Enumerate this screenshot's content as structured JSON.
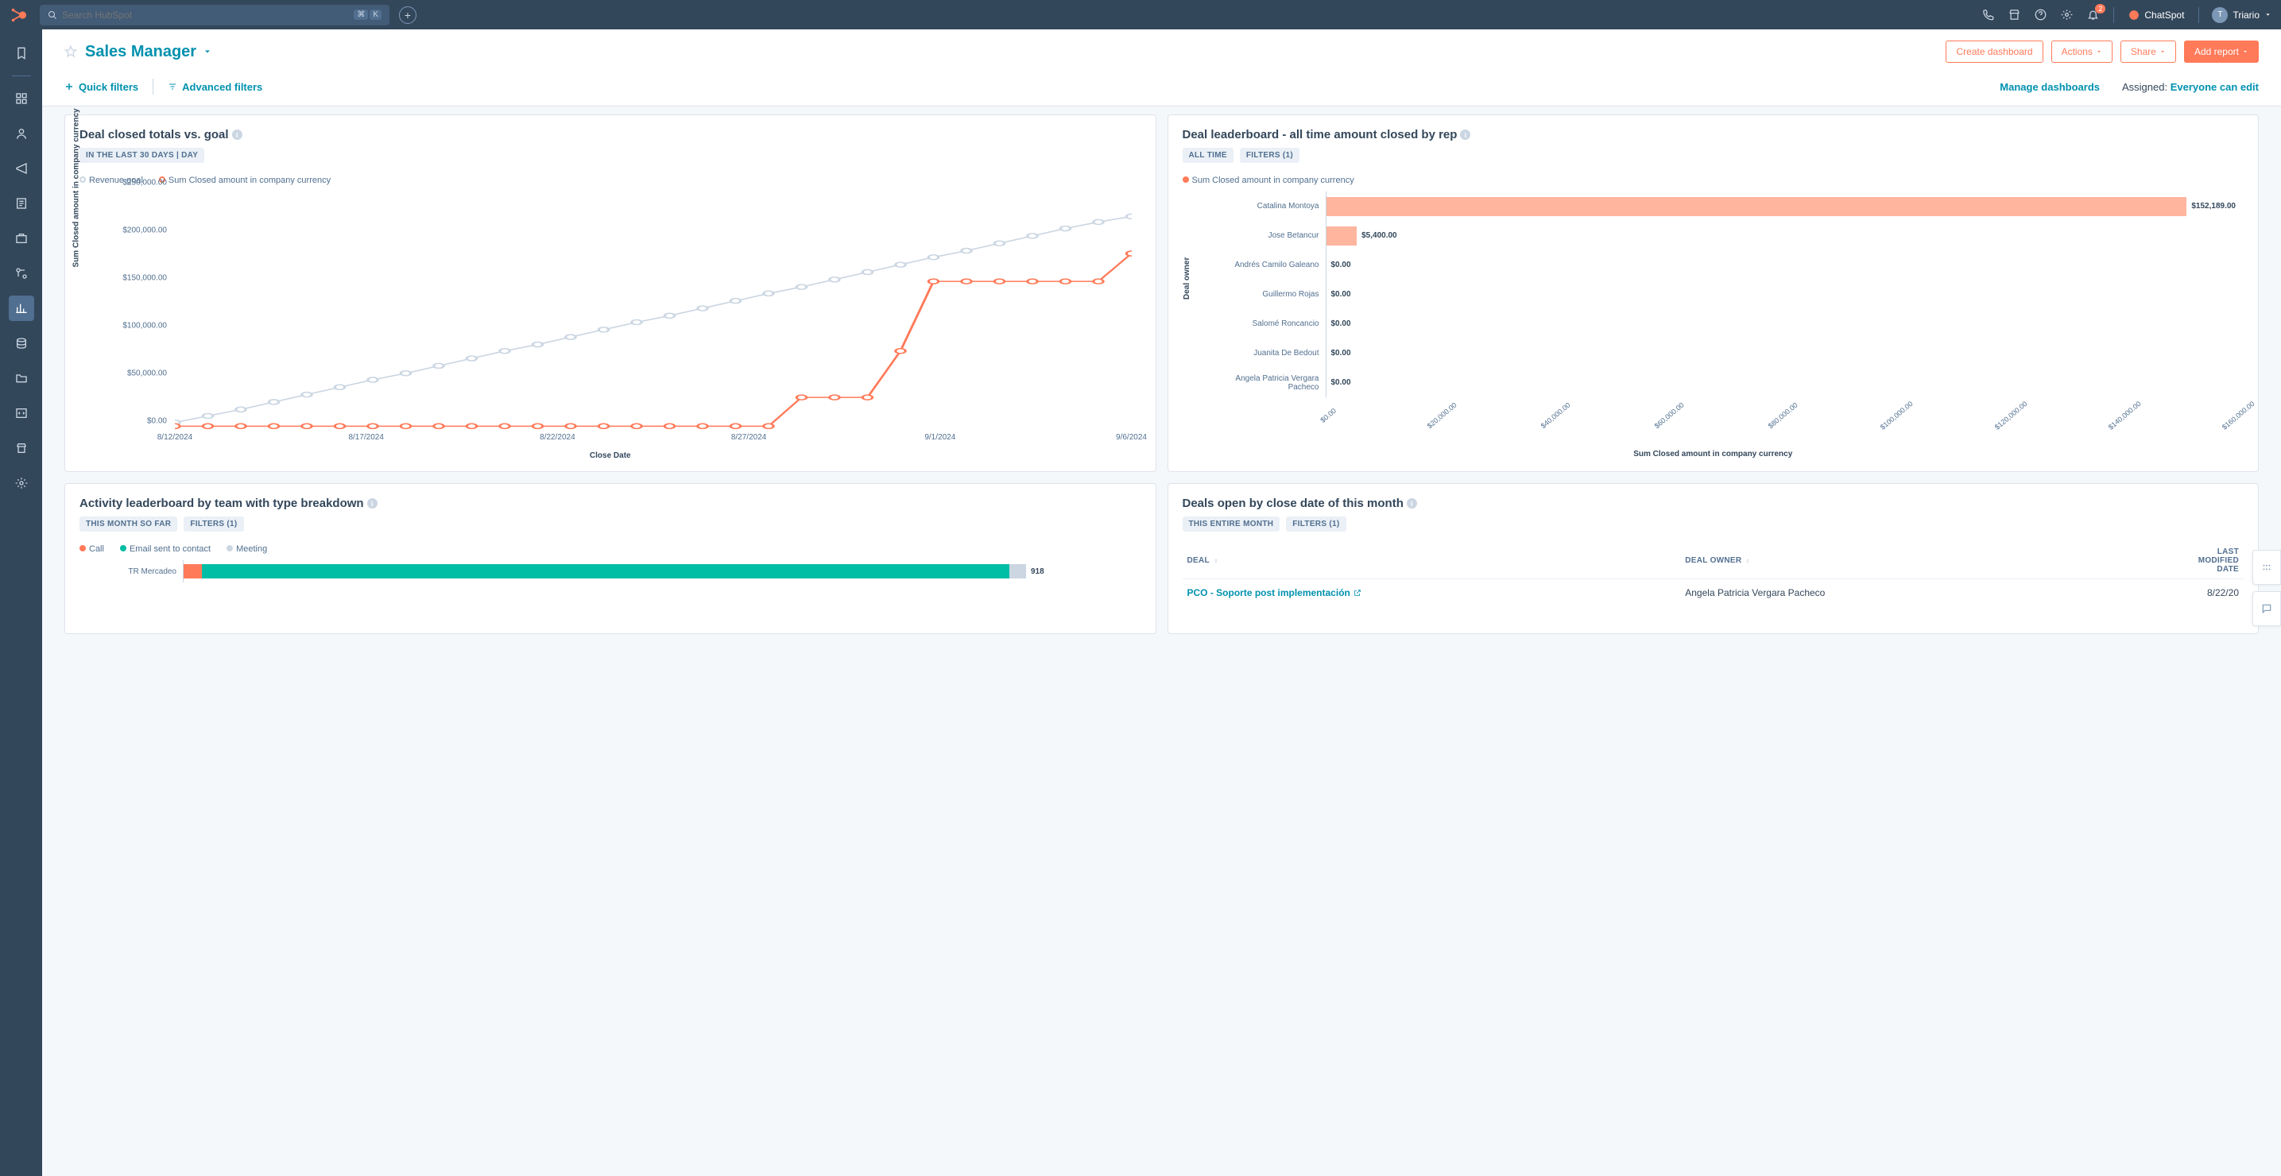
{
  "topnav": {
    "search_placeholder": "Search HubSpot",
    "kbd1": "⌘",
    "kbd2": "K",
    "chatspot": "ChatSpot",
    "user": "Triario",
    "notif_count": "2"
  },
  "header": {
    "title": "Sales Manager",
    "create_dashboard": "Create dashboard",
    "actions": "Actions",
    "share": "Share",
    "add_report": "Add report",
    "quick_filters": "Quick filters",
    "advanced_filters": "Advanced filters",
    "manage_dashboards": "Manage dashboards",
    "assigned_label": "Assigned:",
    "assigned_value": "Everyone can edit"
  },
  "card1": {
    "title": "Deal closed totals vs. goal",
    "pill1": "IN THE LAST 30 DAYS | DAY",
    "legend_goal": "Revenue goal",
    "legend_closed": "Sum Closed amount in company currency",
    "ylabel": "Sum Closed amount in company currency",
    "xlabel": "Close Date"
  },
  "card2": {
    "title": "Deal leaderboard - all time amount closed by rep",
    "pill1": "ALL TIME",
    "pill2": "FILTERS (1)",
    "legend": "Sum Closed amount in company currency",
    "ylabel": "Deal owner",
    "xlabel": "Sum Closed amount in company currency"
  },
  "card3": {
    "title": "Activity leaderboard by team with type breakdown",
    "pill1": "THIS MONTH SO FAR",
    "pill2": "FILTERS (1)",
    "leg_call": "Call",
    "leg_email": "Email sent to contact",
    "leg_meeting": "Meeting"
  },
  "card4": {
    "title": "Deals open by close date of this month",
    "pill1": "THIS ENTIRE MONTH",
    "pill2": "FILTERS (1)",
    "col_deal": "DEAL",
    "col_owner": "DEAL OWNER",
    "col_modified": "LAST MODIFIED DATE",
    "row1_deal": "PCO - Soporte post implementación",
    "row1_owner": "Angela Patricia Vergara Pacheco",
    "row1_date": "8/22/20"
  },
  "chart_data": [
    {
      "type": "line",
      "title": "Deal closed totals vs. goal",
      "xlabel": "Close Date",
      "ylabel": "Sum Closed amount in company currency",
      "ylim": [
        0,
        250000
      ],
      "yticks": [
        "$0.00",
        "$50,000.00",
        "$100,000.00",
        "$150,000.00",
        "$200,000.00",
        "$250,000.00"
      ],
      "xticks": [
        "8/12/2024",
        "8/17/2024",
        "8/22/2024",
        "8/27/2024",
        "9/1/2024",
        "9/6/2024"
      ],
      "x_index": [
        0,
        1,
        2,
        3,
        4,
        5,
        6,
        7,
        8,
        9,
        10,
        11,
        12,
        13,
        14,
        15,
        16,
        17,
        18,
        19,
        20,
        21,
        22,
        23,
        24,
        25,
        26,
        27,
        28,
        29
      ],
      "series": [
        {
          "name": "Revenue goal",
          "color": "#cbd6e2",
          "values": [
            8000,
            15000,
            22000,
            30000,
            38000,
            46000,
            54000,
            61000,
            69000,
            77000,
            85000,
            92000,
            100000,
            108000,
            116000,
            123000,
            131000,
            139000,
            147000,
            154000,
            162000,
            170000,
            178000,
            186000,
            193000,
            201000,
            209000,
            217000,
            224000,
            230000
          ]
        },
        {
          "name": "Sum Closed amount in company currency",
          "color": "#ff7a59",
          "values": [
            4000,
            4000,
            4000,
            4000,
            4000,
            4000,
            4000,
            4000,
            4000,
            4000,
            4000,
            4000,
            4000,
            4000,
            4000,
            4000,
            4000,
            4000,
            4000,
            35000,
            35000,
            35000,
            85000,
            160000,
            160000,
            160000,
            160000,
            160000,
            160000,
            190000
          ]
        }
      ]
    },
    {
      "type": "bar",
      "orientation": "horizontal",
      "title": "Deal leaderboard - all time amount closed by rep",
      "xlabel": "Sum Closed amount in company currency",
      "ylabel": "Deal owner",
      "xlim": [
        0,
        160000
      ],
      "xticks": [
        "$0.00",
        "$20,000.00",
        "$40,000.00",
        "$60,000.00",
        "$80,000.00",
        "$100,000.00",
        "$120,000.00",
        "$140,000.00",
        "$160,000.00"
      ],
      "categories": [
        "Catalina Montoya",
        "Jose Betancur",
        "Andrés Camilo Galeano",
        "Guillermo Rojas",
        "Salomé Roncancio",
        "Juanita De Bedout",
        "Angela Patricia Vergara Pacheco"
      ],
      "values": [
        152189.0,
        5400.0,
        0.0,
        0.0,
        0.0,
        0.0,
        0.0
      ],
      "value_labels": [
        "$152,189.00",
        "$5,400.00",
        "$0.00",
        "$0.00",
        "$0.00",
        "$0.00",
        "$0.00"
      ],
      "color": "#ffb59e"
    },
    {
      "type": "bar",
      "orientation": "horizontal",
      "stacked": true,
      "title": "Activity leaderboard by team with type breakdown",
      "categories": [
        "TR Mercadeo"
      ],
      "series": [
        {
          "name": "Call",
          "color": "#ff7a59",
          "values": [
            20
          ]
        },
        {
          "name": "Email sent to contact",
          "color": "#00bda5",
          "values": [
            880
          ]
        },
        {
          "name": "Meeting",
          "color": "#cbd6e2",
          "values": [
            18
          ]
        }
      ],
      "totals": [
        918
      ]
    },
    {
      "type": "table",
      "title": "Deals open by close date of this month",
      "columns": [
        "DEAL",
        "DEAL OWNER",
        "LAST MODIFIED DATE"
      ],
      "rows": [
        [
          "PCO - Soporte post implementación",
          "Angela Patricia Vergara Pacheco",
          "8/22/20"
        ]
      ]
    }
  ]
}
